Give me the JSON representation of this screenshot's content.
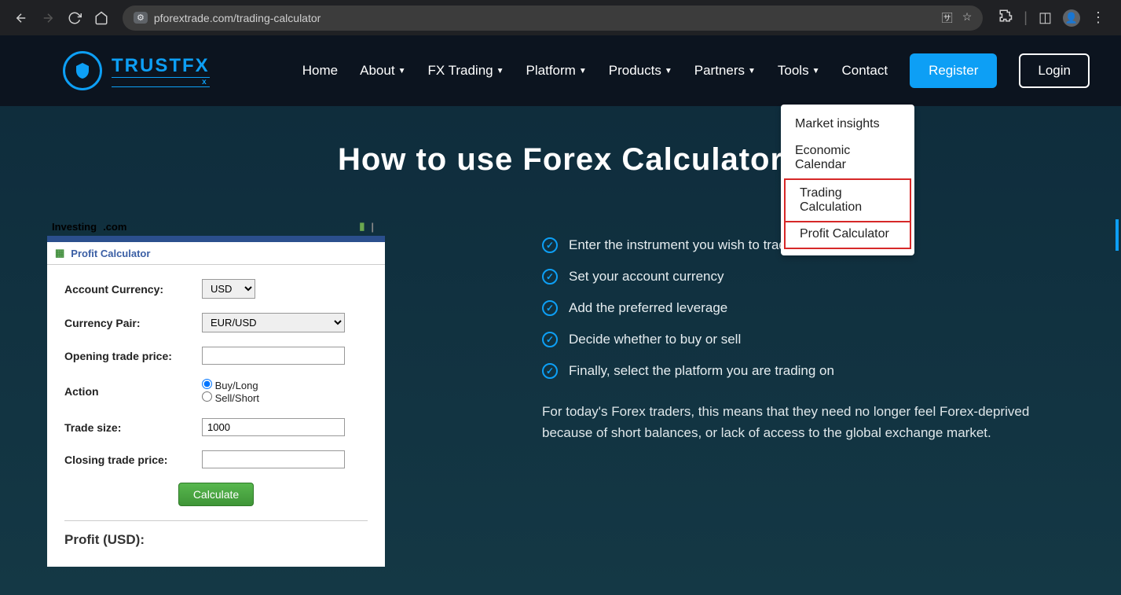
{
  "browser": {
    "url": "pforextrade.com/trading-calculator"
  },
  "nav": {
    "brand_main": "TRUSTFX",
    "brand_sub": "x",
    "items": [
      "Home",
      "About",
      "FX Trading",
      "Platform",
      "Products",
      "Partners",
      "Tools",
      "Contact"
    ],
    "register": "Register",
    "login": "Login"
  },
  "dropdown": {
    "items": [
      "Market insights",
      "Economic Calendar",
      "Trading Calculation",
      "Profit Calculator"
    ],
    "highlighted_index": 2
  },
  "hero": {
    "title": "How to use Forex Calculator"
  },
  "widget": {
    "head_brand": "Investing",
    "head_tld": ".com",
    "title": "Profit Calculator",
    "labels": {
      "account_currency": "Account Currency:",
      "currency_pair": "Currency Pair:",
      "opening_price": "Opening trade price:",
      "action": "Action",
      "trade_size": "Trade size:",
      "closing_price": "Closing trade price:"
    },
    "values": {
      "account_currency": "USD",
      "currency_pair": "EUR/USD",
      "opening_price": "",
      "action_buy": "Buy/Long",
      "action_sell": "Sell/Short",
      "action_selected": "buy",
      "trade_size": "1000",
      "closing_price": ""
    },
    "calculate": "Calculate",
    "result_label": "Profit (USD):"
  },
  "info": {
    "steps": [
      "Enter the instrument you wish to trade",
      "Set your account currency",
      "Add the preferred leverage",
      "Decide whether to buy or sell",
      "Finally, select the platform you are trading on"
    ],
    "paragraph": "For today's Forex traders, this means that they need no longer feel Forex-deprived because of short balances, or lack of access to the global exchange market."
  }
}
